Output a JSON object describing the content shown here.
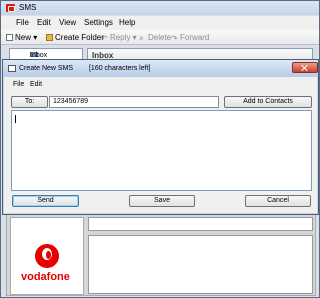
{
  "main_window": {
    "title": "SMS",
    "menu": [
      "File",
      "Edit",
      "View",
      "Settings",
      "Help"
    ],
    "toolbar": {
      "new_label": "New",
      "create_folder_label": "Create Folder",
      "reply_label": "Reply",
      "delete_label": "Delete",
      "forward_label": "Forward"
    },
    "folders": {
      "selected": "Inbox"
    },
    "list": {
      "header": "Inbox"
    },
    "branding": {
      "logo_text": "vodafone"
    }
  },
  "dialog": {
    "title": "Create New SMS",
    "characters_left": "[160 characters left]",
    "menu": [
      "File",
      "Edit"
    ],
    "to_label": "To:",
    "to_value": "123456789",
    "add_contacts_label": "Add to Contacts",
    "message_value": "",
    "send_label": "Send",
    "save_label": "Save",
    "cancel_label": "Cancel"
  },
  "colors": {
    "brand_red": "#e60000",
    "title_blue": "#c4d4e8",
    "close_red": "#c7432d"
  }
}
